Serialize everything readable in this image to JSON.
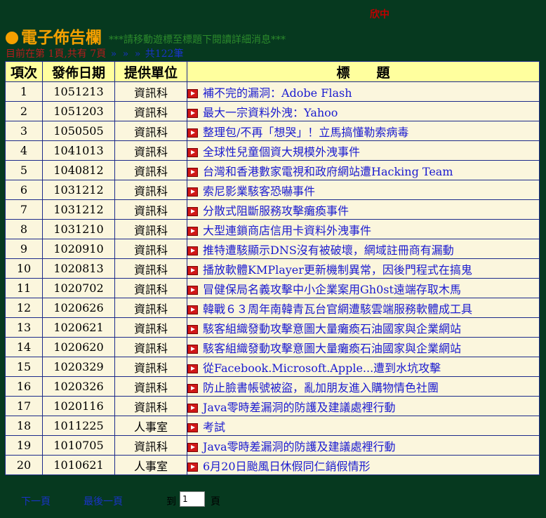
{
  "top_mark": "欣中",
  "header": {
    "title": "電子佈告欄",
    "hint": "***請移動遊標至標題下閱讀詳細消息***"
  },
  "pager": {
    "status": "目前在第 1頁,共有 7頁",
    "arrows": [
      "»",
      "»",
      "»"
    ],
    "total": "共122筆"
  },
  "table": {
    "headers": {
      "no": "項次",
      "date": "發佈日期",
      "unit": "提供單位",
      "title": "標　　題"
    },
    "rows": [
      {
        "no": "1",
        "date": "1051213",
        "unit": "資訊科",
        "title": "補不完的漏洞：Adobe Flash"
      },
      {
        "no": "2",
        "date": "1051203",
        "unit": "資訊科",
        "title": "最大一宗資料外洩：Yahoo"
      },
      {
        "no": "3",
        "date": "1050505",
        "unit": "資訊科",
        "title": "整理包/不再「想哭」！立馬搞懂勒索病毒"
      },
      {
        "no": "4",
        "date": "1041013",
        "unit": "資訊科",
        "title": "全球性兒童個資大規模外洩事件"
      },
      {
        "no": "5",
        "date": "1040812",
        "unit": "資訊科",
        "title": "台灣和香港數家電視和政府網站遭Hacking Team"
      },
      {
        "no": "6",
        "date": "1031212",
        "unit": "資訊科",
        "title": "索尼影業駭客恐嚇事件"
      },
      {
        "no": "7",
        "date": "1031212",
        "unit": "資訊科",
        "title": "分散式阻斷服務攻擊癱瘓事件"
      },
      {
        "no": "8",
        "date": "1031210",
        "unit": "資訊科",
        "title": "大型連鎖商店信用卡資料外洩事件"
      },
      {
        "no": "9",
        "date": "1020910",
        "unit": "資訊科",
        "title": "推特遭駭顯示DNS沒有被破壞，網域註冊商有漏動"
      },
      {
        "no": "10",
        "date": "1020813",
        "unit": "資訊科",
        "title": "播放軟體KMPlayer更新機制異常，因後門程式在搞鬼"
      },
      {
        "no": "11",
        "date": "1020702",
        "unit": "資訊科",
        "title": "冒健保局名義攻擊中小企業案用Gh0st遠端存取木馬"
      },
      {
        "no": "12",
        "date": "1020626",
        "unit": "資訊科",
        "title": "韓戰６３周年南韓青瓦台官網遭駭雲端服務軟體成工具"
      },
      {
        "no": "13",
        "date": "1020621",
        "unit": "資訊科",
        "title": "駭客組織發動攻擊意圖大量癱瘓石油國家與企業網站"
      },
      {
        "no": "14",
        "date": "1020620",
        "unit": "資訊科",
        "title": "駭客組織發動攻擊意圖大量癱瘓石油國家與企業網站"
      },
      {
        "no": "15",
        "date": "1020329",
        "unit": "資訊科",
        "title": "從Facebook.Microsoft.Apple...遭到水坑攻擊"
      },
      {
        "no": "16",
        "date": "1020326",
        "unit": "資訊科",
        "title": "防止臉書帳號被盜，亂加朋友進入購物情色社團"
      },
      {
        "no": "17",
        "date": "1020116",
        "unit": "資訊科",
        "title": "Java零時差漏洞的防護及建議處裡行動"
      },
      {
        "no": "18",
        "date": "1011225",
        "unit": "人事室",
        "title": "考試"
      },
      {
        "no": "19",
        "date": "1010705",
        "unit": "資訊科",
        "title": "Java零時差漏洞的防護及建議處裡行動"
      },
      {
        "no": "20",
        "date": "1010621",
        "unit": "人事室",
        "title": "6月20日颱風日休假同仁銷假情形"
      }
    ]
  },
  "bottom_nav": {
    "next_page": "下一頁",
    "last_page": "最後一頁",
    "goto_prefix": "到",
    "goto_value": "1",
    "goto_suffix": "頁"
  },
  "colors": {
    "background": "#06391f",
    "title": "#f5a000",
    "header_row": "#ffff9e",
    "table_body": "#fbf6dd",
    "link": "#1a1ad0"
  },
  "icons": {
    "title_bullet": "orange-circle",
    "row_icon": "red-play-icon"
  }
}
